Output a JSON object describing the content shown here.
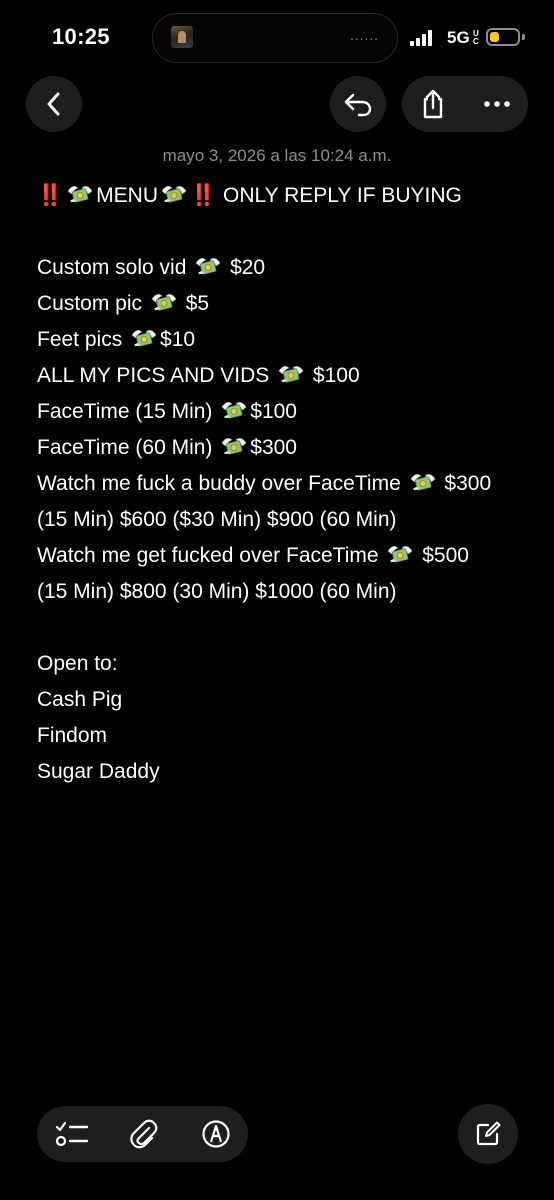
{
  "status_bar": {
    "time": "10:25",
    "network": "5G",
    "network_sub": "UC",
    "battery_percent": 35,
    "battery_color": "#f6c829",
    "island_dots": "......"
  },
  "nav": {
    "back_icon": "chevron-left-icon",
    "undo_icon": "undo-icon",
    "share_icon": "share-icon",
    "more_icon": "ellipsis-icon"
  },
  "note": {
    "date": "mayo 3, 2026 a las 10:24 a.m.",
    "header": {
      "alert": "‼️",
      "menu": "MENU",
      "rest": " ONLY REPLY IF BUYING"
    },
    "lines": [
      {
        "before": "Custom solo vid ",
        "emoji": true,
        "after": " $20"
      },
      {
        "before": "Custom pic ",
        "emoji": true,
        "after": " $5"
      },
      {
        "before": "Feet pics ",
        "emoji": true,
        "after": "$10"
      },
      {
        "before": "ALL MY PICS AND VIDS ",
        "emoji": true,
        "after": " $100"
      },
      {
        "before": "FaceTime (15 Min) ",
        "emoji": true,
        "after": "$100"
      },
      {
        "before": "FaceTime (60 Min) ",
        "emoji": true,
        "after": "$300"
      },
      {
        "before": "Watch me fuck a buddy over FaceTime ",
        "emoji": true,
        "after": " $300"
      },
      {
        "before": "(15 Min) $600 ($30 Min) $900 (60 Min)",
        "emoji": false,
        "after": ""
      },
      {
        "before": "Watch me get fucked over FaceTime ",
        "emoji": true,
        "after": " $500"
      },
      {
        "before": "(15 Min) $800 (30 Min) $1000 (60 Min)",
        "emoji": false,
        "after": ""
      }
    ],
    "open_to_label": "Open to:",
    "open_to": [
      "Cash Pig",
      "Findom",
      "Sugar Daddy"
    ],
    "emoji_name": "money-with-wings-icon"
  },
  "toolbar": {
    "checklist_icon": "checklist-icon",
    "attach_icon": "paperclip-icon",
    "markup_icon": "markup-pen-icon",
    "compose_icon": "compose-icon"
  }
}
